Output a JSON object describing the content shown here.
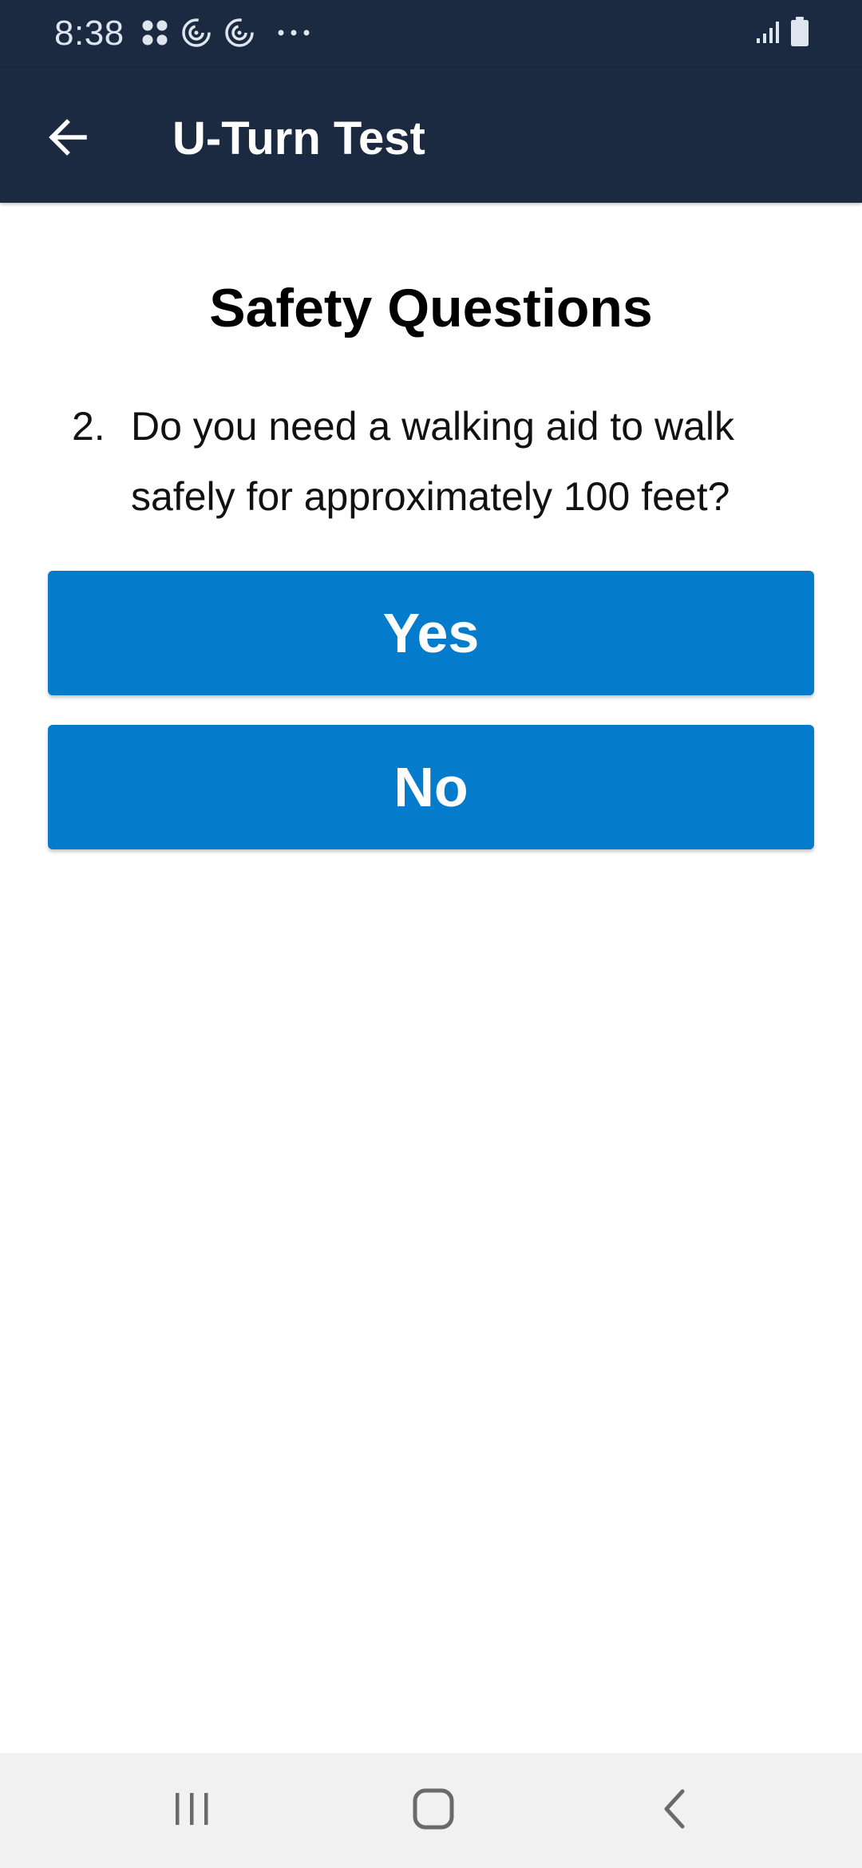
{
  "status_bar": {
    "time": "8:38",
    "left_icons": [
      "apps-grid-icon",
      "sync-icon",
      "sync-icon",
      "more-dots-icon"
    ],
    "right_icons": [
      "signal-icon",
      "battery-icon"
    ]
  },
  "app_bar": {
    "title": "U-Turn Test",
    "back_icon": "arrow-left-icon"
  },
  "content": {
    "section_title": "Safety Questions",
    "question_number": "2.",
    "question_text": "Do you need a walking aid to walk safely for approximately 100 feet?",
    "buttons": {
      "yes_label": "Yes",
      "no_label": "No"
    }
  },
  "nav_bar": {
    "icons": [
      "recent-apps-icon",
      "home-icon",
      "back-chevron-icon"
    ]
  },
  "colors": {
    "app_bar_bg": "#1b2a40",
    "button_bg": "#047bcb",
    "button_text": "#ffffff",
    "nav_bar_bg": "#f1f1f1"
  }
}
